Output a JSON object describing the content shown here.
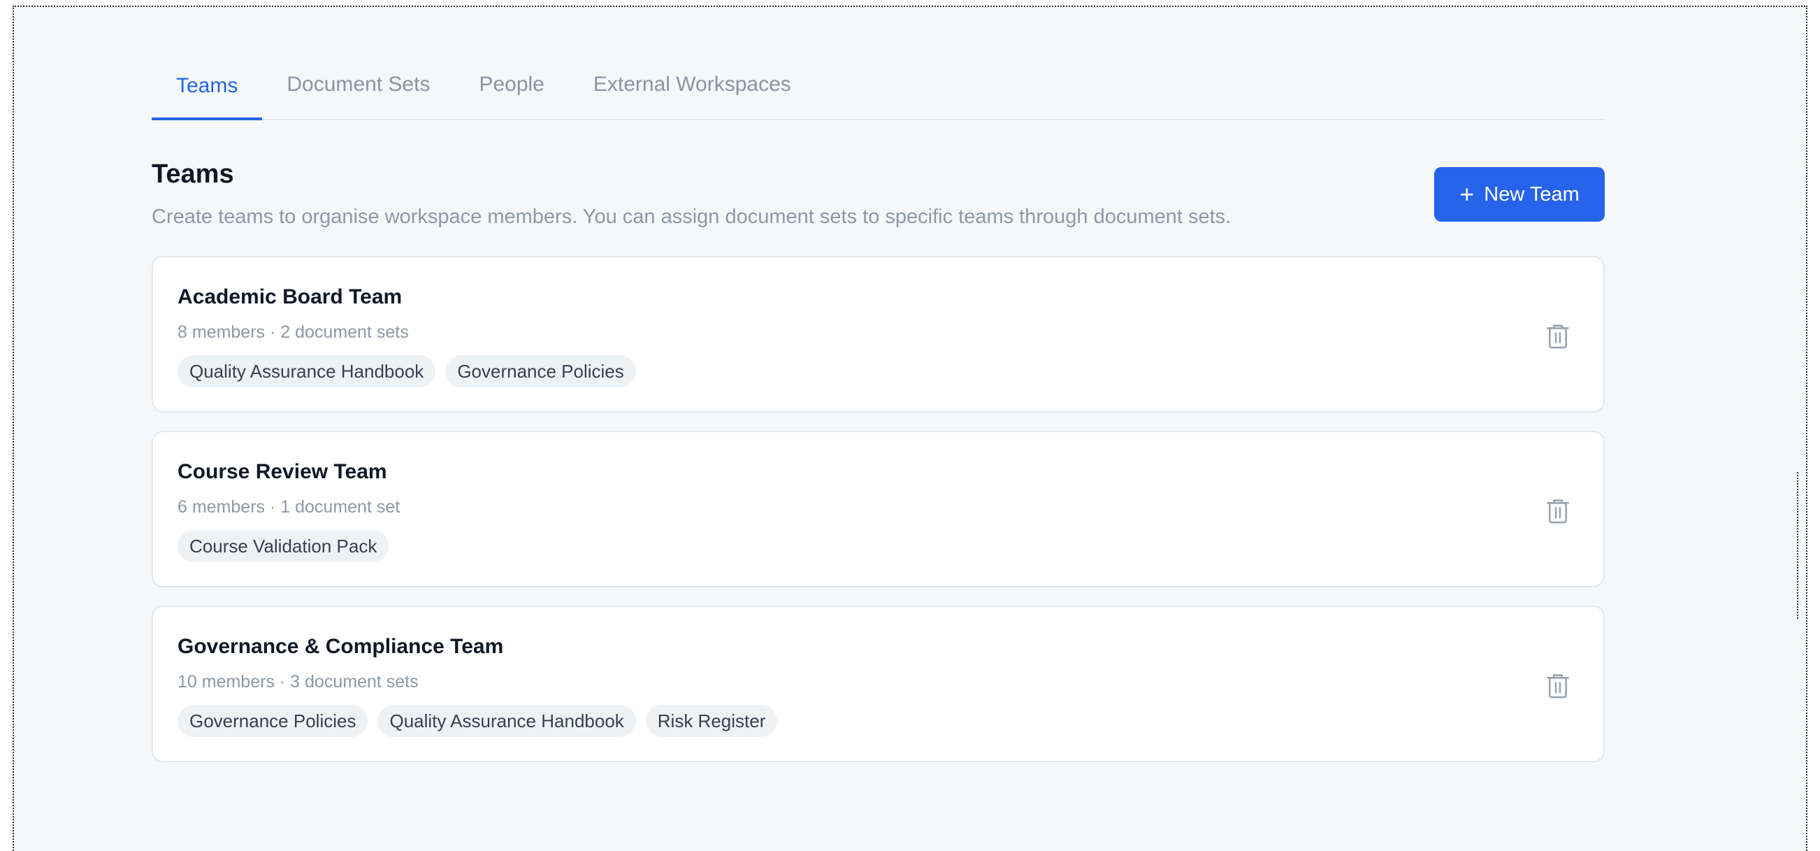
{
  "tabs": [
    {
      "label": "Teams",
      "active": true
    },
    {
      "label": "Document Sets",
      "active": false
    },
    {
      "label": "People",
      "active": false
    },
    {
      "label": "External Workspaces",
      "active": false
    }
  ],
  "header": {
    "title": "Teams",
    "description": "Create teams to organise workspace members. You can assign document sets to specific teams through document sets.",
    "new_team_label": "New Team",
    "new_team_icon": "plus-icon"
  },
  "teams": [
    {
      "name": "Academic Board Team",
      "meta": "8 members · 2 document sets",
      "document_sets": [
        "Quality Assurance Handbook",
        "Governance Policies"
      ]
    },
    {
      "name": "Course Review Team",
      "meta": "6 members · 1 document set",
      "document_sets": [
        "Course Validation Pack"
      ]
    },
    {
      "name": "Governance & Compliance Team",
      "meta": "10 members · 3 document sets",
      "document_sets": [
        "Governance Policies",
        "Quality Assurance Handbook",
        "Risk Register"
      ]
    }
  ],
  "colors": {
    "accent": "#2563eb",
    "background": "#f4f8f9",
    "muted_text": "#8d98a8",
    "chip_bg": "#eef2f5"
  },
  "icons": {
    "delete": "trash-icon"
  }
}
